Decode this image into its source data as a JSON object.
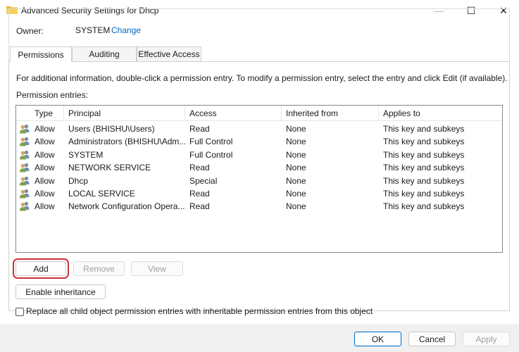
{
  "window": {
    "title": "Advanced Security Settings for Dhcp",
    "icon": "folder-icon",
    "controls": {
      "minimize": "—",
      "maximize": "☐",
      "close": "✕"
    }
  },
  "owner": {
    "label": "Owner:",
    "value": "SYSTEM",
    "change_link": "Change"
  },
  "tabs": [
    {
      "label": "Permissions",
      "active": true
    },
    {
      "label": "Auditing",
      "active": false
    },
    {
      "label": "Effective Access",
      "active": false
    }
  ],
  "info_text": "For additional information, double-click a permission entry. To modify a permission entry, select the entry and click Edit (if available).",
  "entries_label": "Permission entries:",
  "grid": {
    "columns": [
      "Type",
      "Principal",
      "Access",
      "Inherited from",
      "Applies to"
    ],
    "rows": [
      {
        "type": "Allow",
        "principal": "Users (BHISHU\\Users)",
        "access": "Read",
        "inherited": "None",
        "applies": "This key and subkeys"
      },
      {
        "type": "Allow",
        "principal": "Administrators (BHISHU\\Adm...",
        "access": "Full Control",
        "inherited": "None",
        "applies": "This key and subkeys"
      },
      {
        "type": "Allow",
        "principal": "SYSTEM",
        "access": "Full Control",
        "inherited": "None",
        "applies": "This key and subkeys"
      },
      {
        "type": "Allow",
        "principal": "NETWORK SERVICE",
        "access": "Read",
        "inherited": "None",
        "applies": "This key and subkeys"
      },
      {
        "type": "Allow",
        "principal": "Dhcp",
        "access": "Special",
        "inherited": "None",
        "applies": "This key and subkeys"
      },
      {
        "type": "Allow",
        "principal": "LOCAL SERVICE",
        "access": "Read",
        "inherited": "None",
        "applies": "This key and subkeys"
      },
      {
        "type": "Allow",
        "principal": "Network Configuration Opera...",
        "access": "Read",
        "inherited": "None",
        "applies": "This key and subkeys"
      }
    ]
  },
  "buttons": {
    "add": "Add",
    "remove": "Remove",
    "view": "View",
    "enable_inheritance": "Enable inheritance",
    "ok": "OK",
    "cancel": "Cancel",
    "apply": "Apply"
  },
  "checkbox": {
    "label": "Replace all child object permission entries with inheritable permission entries from this object",
    "checked": false
  },
  "colors": {
    "link": "#0067c0",
    "highlight": "#c8323c"
  }
}
